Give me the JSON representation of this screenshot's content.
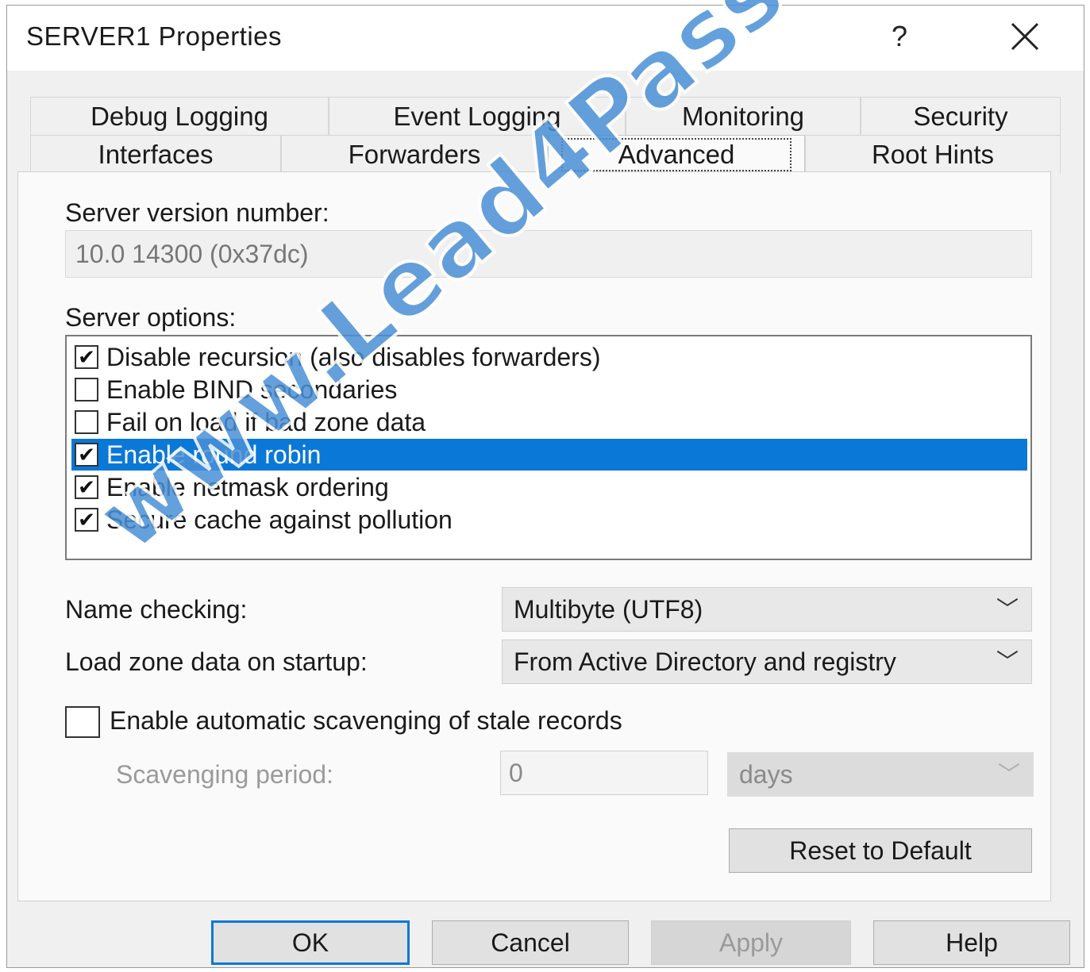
{
  "window": {
    "title": "SERVER1 Properties",
    "help_glyph": "?",
    "close_glyph": "✕"
  },
  "tabs": {
    "row1": [
      "Debug Logging",
      "Event Logging",
      "Monitoring",
      "Security"
    ],
    "row2": [
      "Interfaces",
      "Forwarders",
      "Advanced",
      "Root Hints"
    ],
    "active": "Advanced"
  },
  "advanced": {
    "version_label": "Server version number:",
    "version_value": "10.0 14300 (0x37dc)",
    "options_label": "Server options:",
    "options": [
      {
        "label": "Disable recursion (also disables forwarders)",
        "checked": true,
        "selected": false
      },
      {
        "label": "Enable BIND secondaries",
        "checked": false,
        "selected": false
      },
      {
        "label": "Fail on load if bad zone data",
        "checked": false,
        "selected": false
      },
      {
        "label": "Enable round robin",
        "checked": true,
        "selected": true
      },
      {
        "label": "Enable netmask ordering",
        "checked": true,
        "selected": false
      },
      {
        "label": "Secure cache against pollution",
        "checked": true,
        "selected": false
      }
    ],
    "name_checking_label": "Name checking:",
    "name_checking_value": "Multibyte (UTF8)",
    "load_zone_label": "Load zone data on startup:",
    "load_zone_value": "From Active Directory and registry",
    "scavenging_label": "Enable automatic scavenging of stale records",
    "scavenging_checked": false,
    "scavenging_period_label": "Scavenging period:",
    "scavenging_period_value": "0",
    "scavenging_unit": "days",
    "reset_label": "Reset to Default"
  },
  "buttons": {
    "ok": "OK",
    "cancel": "Cancel",
    "apply": "Apply",
    "help": "Help"
  },
  "watermark": "www.Lead4Pass.com",
  "colors": {
    "selection": "#0a78d7",
    "dialog_bg": "#f0f0f0",
    "watermark": "#4a90d6"
  }
}
